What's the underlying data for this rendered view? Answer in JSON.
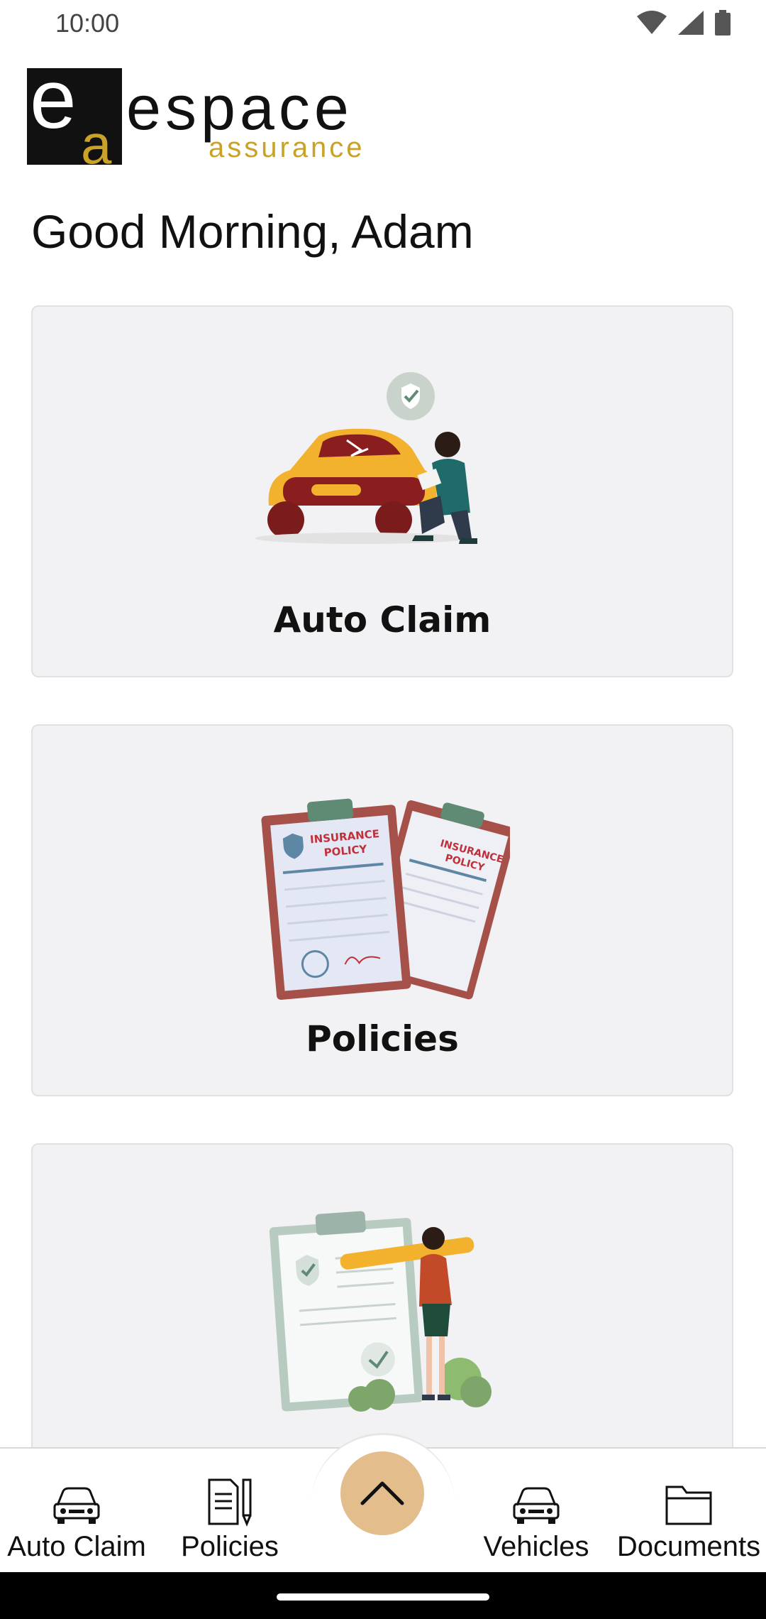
{
  "status_bar": {
    "time": "10:00",
    "icons": [
      "wifi-icon",
      "cell-signal-icon",
      "battery-icon"
    ]
  },
  "logo": {
    "letter_e": "e",
    "letter_a": "a",
    "main_text": "espace",
    "sub_text": "assurance"
  },
  "greeting": "Good Morning, Adam",
  "cards": [
    {
      "label": "Auto Claim",
      "illustration": "car-damage-illustration"
    },
    {
      "label": "Policies",
      "illustration": "insurance-policy-illustration",
      "doc_title_line1": "INSURANCE",
      "doc_title_line2": "POLICY"
    },
    {
      "label": "",
      "illustration": "checklist-illustration"
    }
  ],
  "bottom_nav": {
    "items": [
      {
        "label": "Auto Claim",
        "icon": "car-icon"
      },
      {
        "label": "Policies",
        "icon": "document-pen-icon"
      },
      {
        "label": "Vehicles",
        "icon": "car-icon"
      },
      {
        "label": "Documents",
        "icon": "folder-icon"
      }
    ],
    "fab_icon": "chevron-up-icon"
  },
  "colors": {
    "accent_gold": "#c9a227",
    "fab_bg": "#e3bd8b",
    "card_bg": "#f2f2f4"
  }
}
